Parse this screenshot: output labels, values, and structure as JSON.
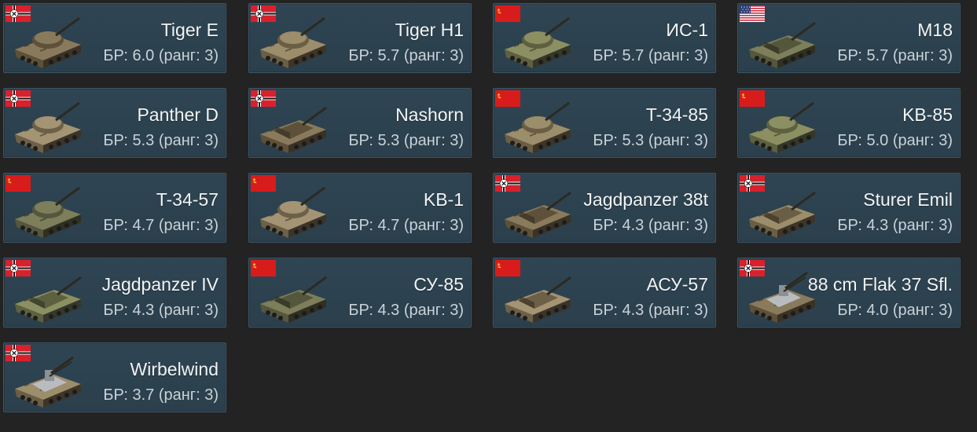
{
  "colors": {
    "background": "#232324",
    "card": "#2f4553",
    "card_border": "#3c5666",
    "name_text": "#f2f4f5",
    "br_text": "#c9d2d8"
  },
  "vehicles": [
    {
      "name": "Tiger E",
      "br": "БР: 6.0 (ранг: 3)",
      "nation": "germany-flag-icon",
      "icon": "heavy-tank-icon"
    },
    {
      "name": "Tiger H1",
      "br": "БР: 5.7 (ранг: 3)",
      "nation": "germany-flag-icon",
      "icon": "heavy-tank-icon"
    },
    {
      "name": "ИС-1",
      "br": "БР: 5.7 (ранг: 3)",
      "nation": "ussr-flag-icon",
      "icon": "heavy-tank-icon"
    },
    {
      "name": "M18",
      "br": "БР: 5.7 (ранг: 3)",
      "nation": "usa-flag-icon",
      "icon": "tank-destroyer-icon"
    },
    {
      "name": "Panther D",
      "br": "БР: 5.3 (ранг: 3)",
      "nation": "germany-flag-icon",
      "icon": "medium-tank-icon"
    },
    {
      "name": "Nashorn",
      "br": "БР: 5.3 (ранг: 3)",
      "nation": "germany-flag-icon",
      "icon": "tank-destroyer-icon"
    },
    {
      "name": "T-34-85",
      "br": "БР: 5.3 (ранг: 3)",
      "nation": "ussr-flag-icon",
      "icon": "medium-tank-icon"
    },
    {
      "name": "KB-85",
      "br": "БР: 5.0 (ранг: 3)",
      "nation": "ussr-flag-icon",
      "icon": "heavy-tank-icon"
    },
    {
      "name": "T-34-57",
      "br": "БР: 4.7 (ранг: 3)",
      "nation": "ussr-flag-icon",
      "icon": "medium-tank-icon"
    },
    {
      "name": "KB-1",
      "br": "БР: 4.7 (ранг: 3)",
      "nation": "ussr-flag-icon",
      "icon": "heavy-tank-icon"
    },
    {
      "name": "Jagdpanzer 38t",
      "br": "БР: 4.3 (ранг: 3)",
      "nation": "germany-flag-icon",
      "icon": "tank-destroyer-icon"
    },
    {
      "name": "Sturer Emil",
      "br": "БР: 4.3 (ранг: 3)",
      "nation": "germany-flag-icon",
      "icon": "tank-destroyer-icon"
    },
    {
      "name": "Jagdpanzer IV",
      "br": "БР: 4.3 (ранг: 3)",
      "nation": "germany-flag-icon",
      "icon": "tank-destroyer-icon"
    },
    {
      "name": "СУ-85",
      "br": "БР: 4.3 (ранг: 3)",
      "nation": "ussr-flag-icon",
      "icon": "tank-destroyer-icon"
    },
    {
      "name": "АСУ-57",
      "br": "БР: 4.3 (ранг: 3)",
      "nation": "ussr-flag-icon",
      "icon": "tank-destroyer-icon"
    },
    {
      "name": "88 cm Flak 37 Sfl.",
      "br": "БР: 4.0 (ранг: 3)",
      "nation": "germany-flag-icon",
      "icon": "spaa-icon"
    },
    {
      "name": "Wirbelwind",
      "br": "БР: 3.7 (ранг: 3)",
      "nation": "germany-flag-icon",
      "icon": "spaa-icon"
    }
  ]
}
